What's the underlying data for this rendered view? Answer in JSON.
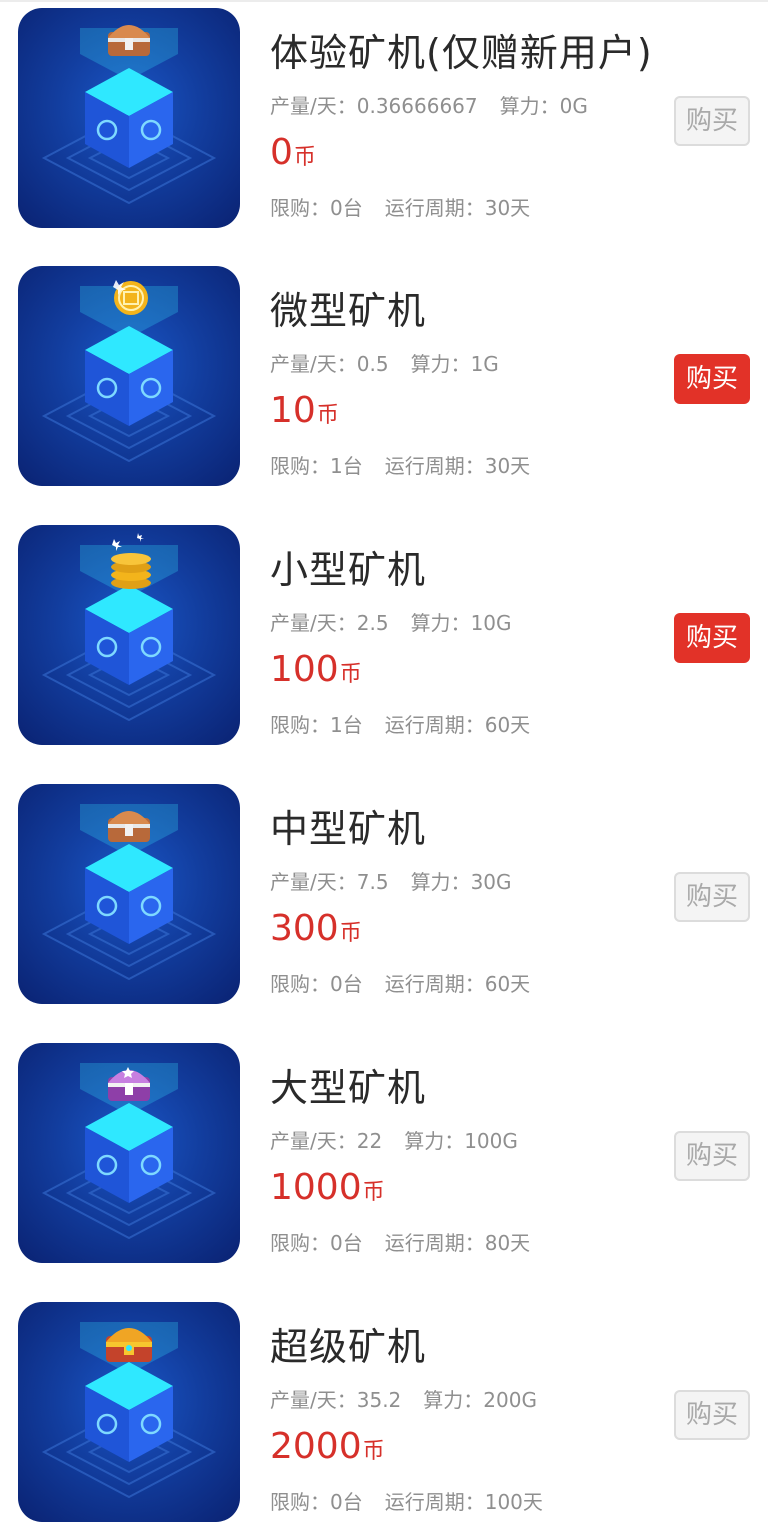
{
  "products": [
    {
      "title": "体验矿机(仅赠新用户)",
      "output_label": "产量/天：",
      "output_value": "0.36666667",
      "power_label": "算力：",
      "power_value": "0G",
      "price": "0",
      "price_unit": "币",
      "limit_label": "限购：",
      "limit_value": "0台",
      "cycle_label": "运行周期：",
      "cycle_value": "30天",
      "buy_label": "购买",
      "buy_enabled": false,
      "prize_icon": "treasure-chest-brown-icon"
    },
    {
      "title": "微型矿机",
      "output_label": "产量/天：",
      "output_value": "0.5",
      "power_label": "算力：",
      "power_value": "1G",
      "price": "10",
      "price_unit": "币",
      "limit_label": "限购：",
      "limit_value": "1台",
      "cycle_label": "运行周期：",
      "cycle_value": "30天",
      "buy_label": "购买",
      "buy_enabled": true,
      "prize_icon": "gold-coin-icon"
    },
    {
      "title": "小型矿机",
      "output_label": "产量/天：",
      "output_value": "2.5",
      "power_label": "算力：",
      "power_value": "10G",
      "price": "100",
      "price_unit": "币",
      "limit_label": "限购：",
      "limit_value": "1台",
      "cycle_label": "运行周期：",
      "cycle_value": "60天",
      "buy_label": "购买",
      "buy_enabled": true,
      "prize_icon": "coin-stack-icon"
    },
    {
      "title": "中型矿机",
      "output_label": "产量/天：",
      "output_value": "7.5",
      "power_label": "算力：",
      "power_value": "30G",
      "price": "300",
      "price_unit": "币",
      "limit_label": "限购：",
      "limit_value": "0台",
      "cycle_label": "运行周期：",
      "cycle_value": "60天",
      "buy_label": "购买",
      "buy_enabled": false,
      "prize_icon": "treasure-chest-brown-icon"
    },
    {
      "title": "大型矿机",
      "output_label": "产量/天：",
      "output_value": "22",
      "power_label": "算力：",
      "power_value": "100G",
      "price": "1000",
      "price_unit": "币",
      "limit_label": "限购：",
      "limit_value": "0台",
      "cycle_label": "运行周期：",
      "cycle_value": "80天",
      "buy_label": "购买",
      "buy_enabled": false,
      "prize_icon": "treasure-chest-purple-icon"
    },
    {
      "title": "超级矿机",
      "output_label": "产量/天：",
      "output_value": "35.2",
      "power_label": "算力：",
      "power_value": "200G",
      "price": "2000",
      "price_unit": "币",
      "limit_label": "限购：",
      "limit_value": "0台",
      "cycle_label": "运行周期：",
      "cycle_value": "100天",
      "buy_label": "购买",
      "buy_enabled": false,
      "prize_icon": "treasure-chest-gold-icon"
    }
  ],
  "colors": {
    "price_red": "#d6302a",
    "buy_active_bg": "#e23228",
    "buy_disabled_bg": "#f4f4f4",
    "thumb_blue": "#123d9e",
    "cube_cyan": "#2fe8ff"
  }
}
